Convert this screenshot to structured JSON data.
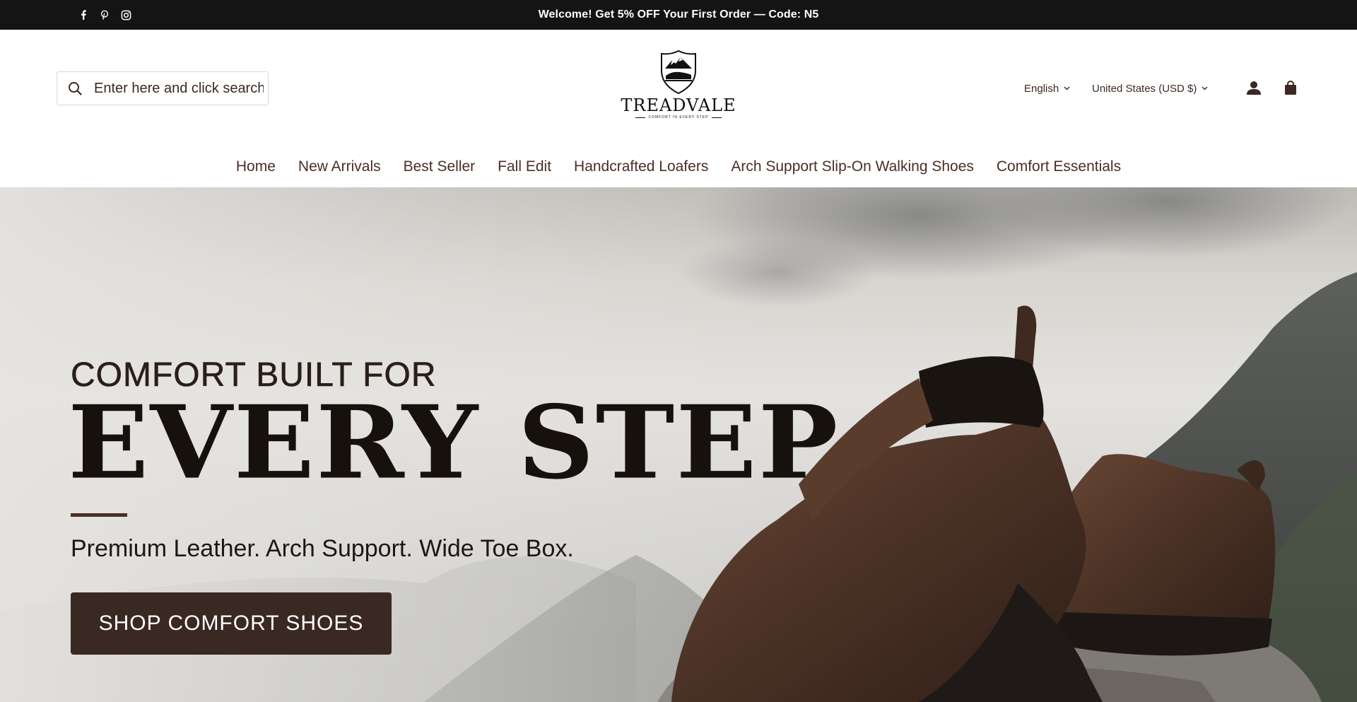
{
  "announcement": {
    "message": "Welcome! Get 5% OFF Your First Order — Code: N5",
    "social_icons": [
      "facebook-icon",
      "pinterest-icon",
      "instagram-icon"
    ]
  },
  "header": {
    "search": {
      "placeholder": "Enter here and click search",
      "value": ""
    },
    "logo": {
      "name": "TREADVALE",
      "tagline": "COMFORT IN EVERY STEP"
    },
    "language": {
      "selected": "English"
    },
    "currency": {
      "selected": "United States (USD $)"
    },
    "icons": [
      "account-icon",
      "cart-icon"
    ]
  },
  "nav": {
    "items": [
      {
        "label": "Home"
      },
      {
        "label": "New Arrivals"
      },
      {
        "label": "Best Seller"
      },
      {
        "label": "Fall Edit"
      },
      {
        "label": "Handcrafted Loafers"
      },
      {
        "label": "Arch Support Slip-On Walking Shoes"
      },
      {
        "label": "Comfort Essentials"
      }
    ]
  },
  "hero": {
    "eyebrow": "COMFORT BUILT FOR",
    "headline": "EVERY STEP",
    "subheadline": "Premium Leather. Arch Support. Wide Toe Box.",
    "cta_label": "SHOP COMFORT SHOES"
  },
  "colors": {
    "announcement_bg": "#141414",
    "text_brown": "#4a2e24",
    "cta_bg": "#3a2822",
    "headline": "#17110e"
  }
}
